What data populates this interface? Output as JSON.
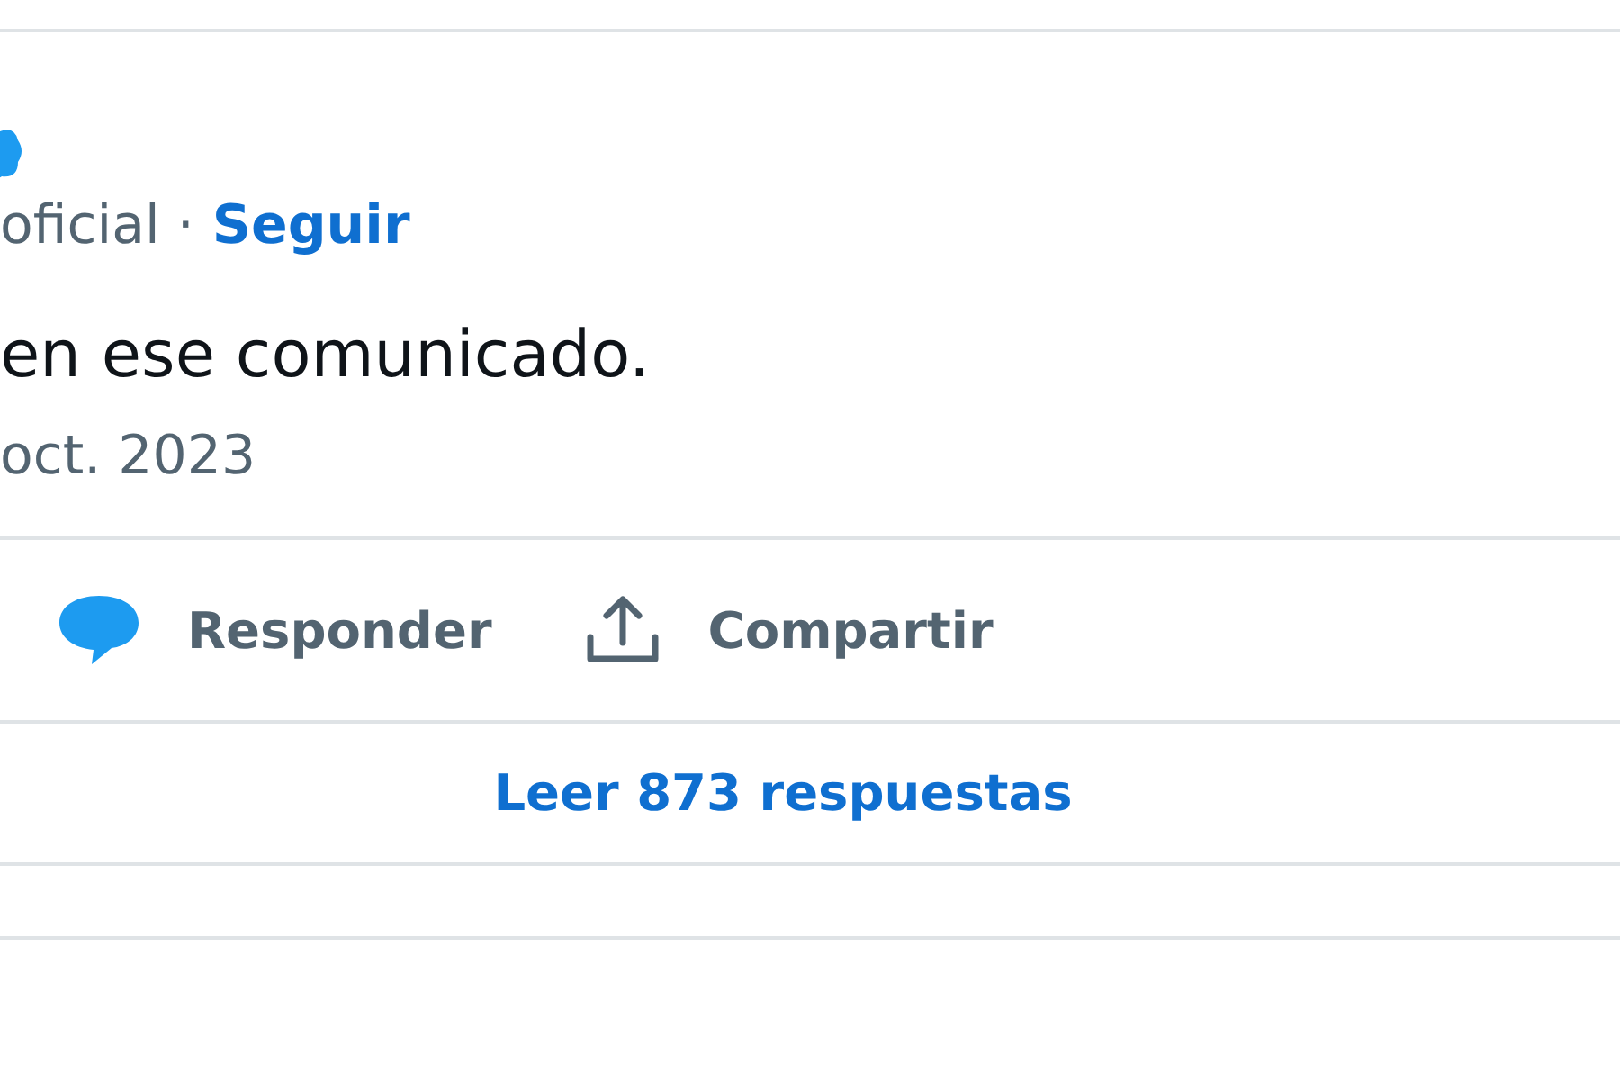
{
  "author": {
    "verified": true,
    "handle_suffix": "oficial ·",
    "follow_label": "Seguir"
  },
  "tweet": {
    "text": "en ese comunicado.",
    "date": "oct. 2023"
  },
  "actions": [
    {
      "kind": "reply",
      "label": "Responder"
    },
    {
      "kind": "share",
      "label": "Compartir"
    }
  ],
  "replies_link": "Leer 873 respuestas"
}
